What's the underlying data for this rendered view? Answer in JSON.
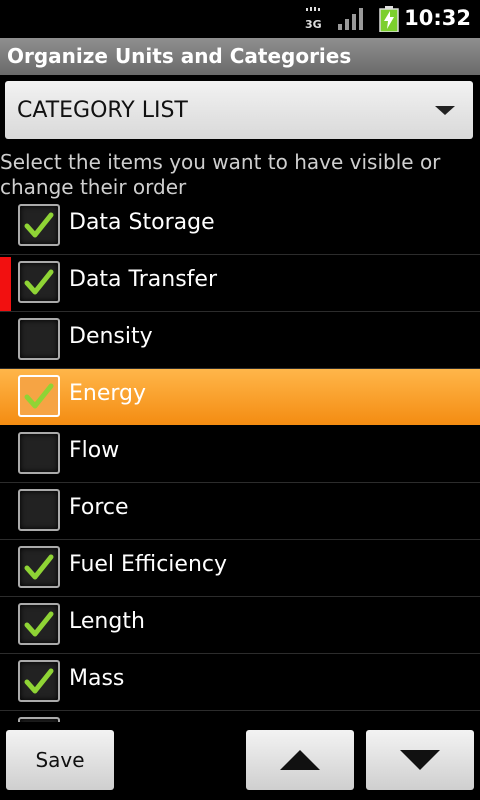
{
  "status_bar": {
    "network": "3G",
    "time": "10:32",
    "icons": [
      "3g-icon",
      "signal-icon",
      "battery-charging-icon"
    ]
  },
  "title_bar": {
    "title": "Organize Units and Categories"
  },
  "spinner": {
    "selected": "CATEGORY LIST"
  },
  "instructions": "Select the items you want to have visible or change their order",
  "items": [
    {
      "label": "Data Storage",
      "checked": true,
      "selected": false,
      "dragging": false
    },
    {
      "label": "Data Transfer",
      "checked": true,
      "selected": false,
      "dragging": true
    },
    {
      "label": "Density",
      "checked": false,
      "selected": false,
      "dragging": false
    },
    {
      "label": "Energy",
      "checked": true,
      "selected": true,
      "dragging": false
    },
    {
      "label": "Flow",
      "checked": false,
      "selected": false,
      "dragging": false
    },
    {
      "label": "Force",
      "checked": false,
      "selected": false,
      "dragging": false
    },
    {
      "label": "Fuel Efficiency",
      "checked": true,
      "selected": false,
      "dragging": false
    },
    {
      "label": "Length",
      "checked": true,
      "selected": false,
      "dragging": false
    },
    {
      "label": "Mass",
      "checked": true,
      "selected": false,
      "dragging": false
    }
  ],
  "buttons": {
    "save_label": "Save",
    "move_up_icon": "arrow-up-icon",
    "move_down_icon": "arrow-down-icon"
  },
  "colors": {
    "check": "#8fd435",
    "selected_row": "#f48c12",
    "drag_indicator": "#f21010"
  }
}
